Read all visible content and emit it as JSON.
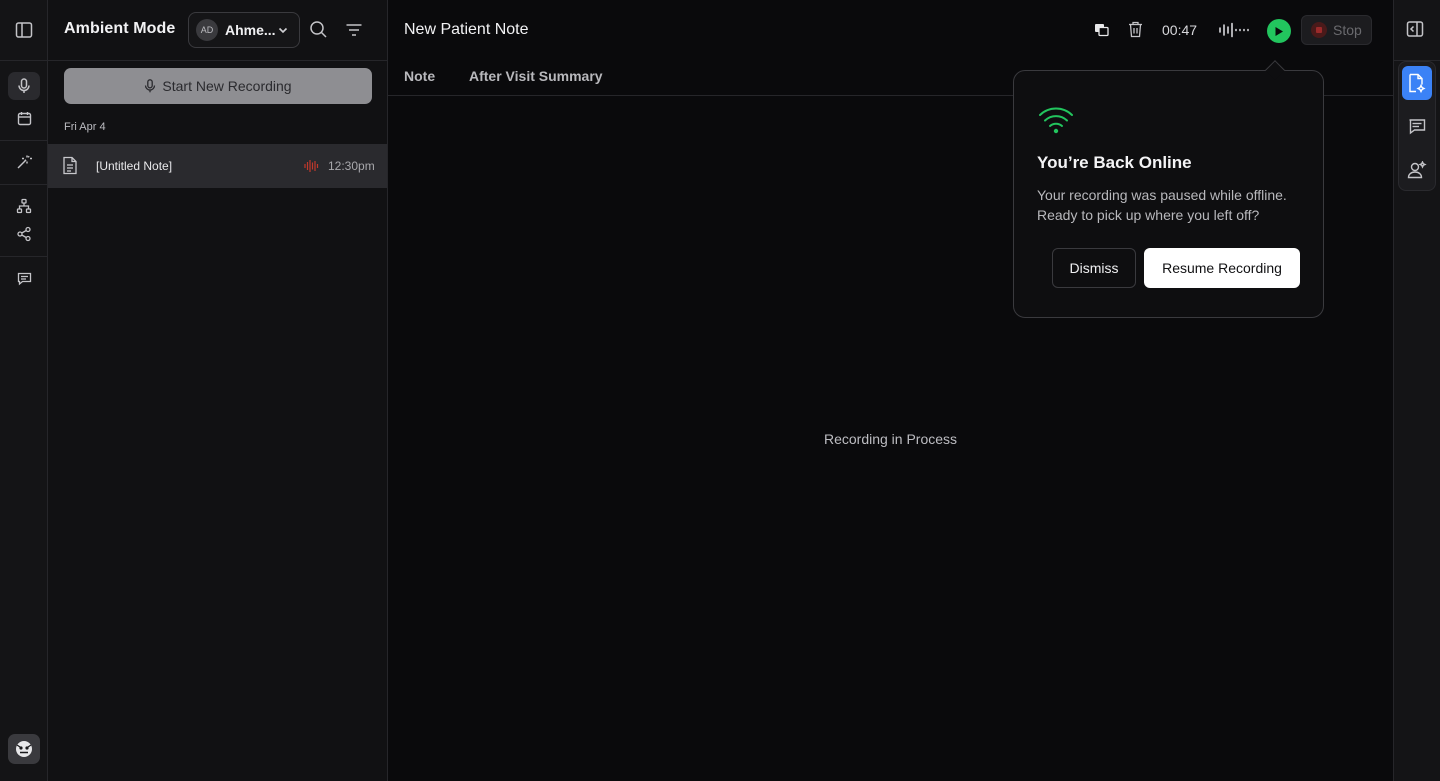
{
  "sidebar": {
    "title": "Ambient Mode",
    "user": {
      "initials": "AD",
      "name": "Ahme..."
    },
    "start_button": "Start New Recording",
    "date_group": "Fri Apr 4",
    "notes": [
      {
        "title": "[Untitled Note]",
        "time": "12:30pm"
      }
    ]
  },
  "main": {
    "title": "New Patient Note",
    "timer": "00:47",
    "stop_label": "Stop",
    "tabs": [
      {
        "label": "Note"
      },
      {
        "label": "After Visit Summary"
      }
    ],
    "center_text": "Recording in Process"
  },
  "popover": {
    "title": "You’re Back Online",
    "body": "Your recording was paused while offline. Ready to pick up where you left off?",
    "dismiss_label": "Dismiss",
    "resume_label": "Resume Recording"
  },
  "colors": {
    "accent_blue": "#3b82f6",
    "play_green": "#22c55e",
    "wifi_green": "#22c55e",
    "recording_red": "#c0392b"
  }
}
